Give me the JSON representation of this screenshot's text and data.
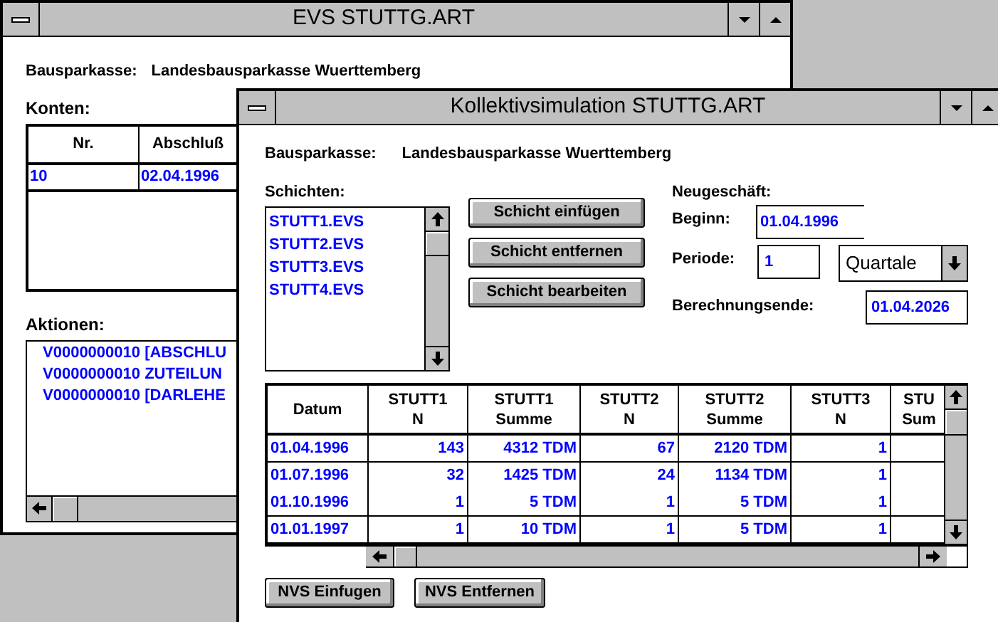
{
  "back_window": {
    "title": "EVS STUTTG.ART",
    "bank_label": "Bausparkasse:",
    "bank": "Landesbausparkasse Wuerttemberg",
    "accounts_label": "Konten:",
    "accounts_columns": [
      "Nr.",
      "Abschluß"
    ],
    "accounts_rows": [
      [
        "10",
        "02.04.1996"
      ]
    ],
    "actions_label": "Aktionen:",
    "actions": [
      "V0000000010 [ABSCHLU",
      "V0000000010 ZUTEILUN",
      "V0000000010 [DARLEHE"
    ]
  },
  "front_window": {
    "title": "Kollektivsimulation STUTTG.ART",
    "bank_label": "Bausparkasse:",
    "bank": "Landesbausparkasse Wuerttemberg",
    "layers_label": "Schichten:",
    "layers": [
      "STUTT1.EVS",
      "STUTT2.EVS",
      "STUTT3.EVS",
      "STUTT4.EVS"
    ],
    "layer_buttons": [
      "Schicht einfügen",
      "Schicht entfernen",
      "Schicht bearbeiten"
    ],
    "new_business_label": "Neugeschäft:",
    "start_label": "Beginn:",
    "start_value": "01.04.1996",
    "period_label": "Periode:",
    "period_value": "1",
    "period_unit": "Quartale",
    "end_label": "Berechnungsende:",
    "end_value": "01.04.2026",
    "table_columns": [
      "Datum",
      "STUTT1\nN",
      "STUTT1\nSumme",
      "STUTT2\nN",
      "STUTT2\nSumme",
      "STUTT3\nN",
      "STU\nSum"
    ],
    "table_rows": [
      [
        "01.04.1996",
        "143",
        "4312 TDM",
        "67",
        "2120 TDM",
        "1",
        ""
      ],
      [
        "01.07.1996",
        "32",
        "1425 TDM",
        "24",
        "1134 TDM",
        "1",
        ""
      ],
      [
        "01.10.1996",
        "1",
        "5 TDM",
        "1",
        "5 TDM",
        "1",
        ""
      ],
      [
        "01.01.1997",
        "1",
        "10 TDM",
        "1",
        "5 TDM",
        "1",
        ""
      ]
    ],
    "bottom_buttons": [
      "NVS Einfugen",
      "NVS Entfernen"
    ]
  }
}
